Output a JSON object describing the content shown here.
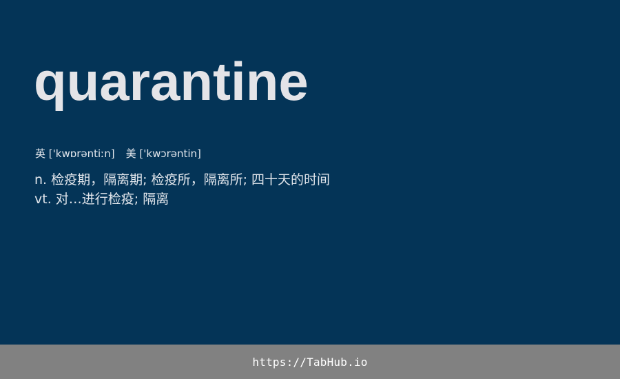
{
  "word": "quarantine",
  "phonetics": {
    "uk_label": "英",
    "uk_ipa": "['kwɒrəntiːn]",
    "us_label": "美",
    "us_ipa": "['kwɔrəntin]"
  },
  "definitions": [
    "n. 检疫期，隔离期; 检疫所，隔离所; 四十天的时间",
    "vt. 对…进行检疫; 隔离"
  ],
  "footer": {
    "link": "https://TabHub.io"
  },
  "colors": {
    "background": "#043457",
    "footer": "#818181",
    "word": "#e4e4e8"
  }
}
